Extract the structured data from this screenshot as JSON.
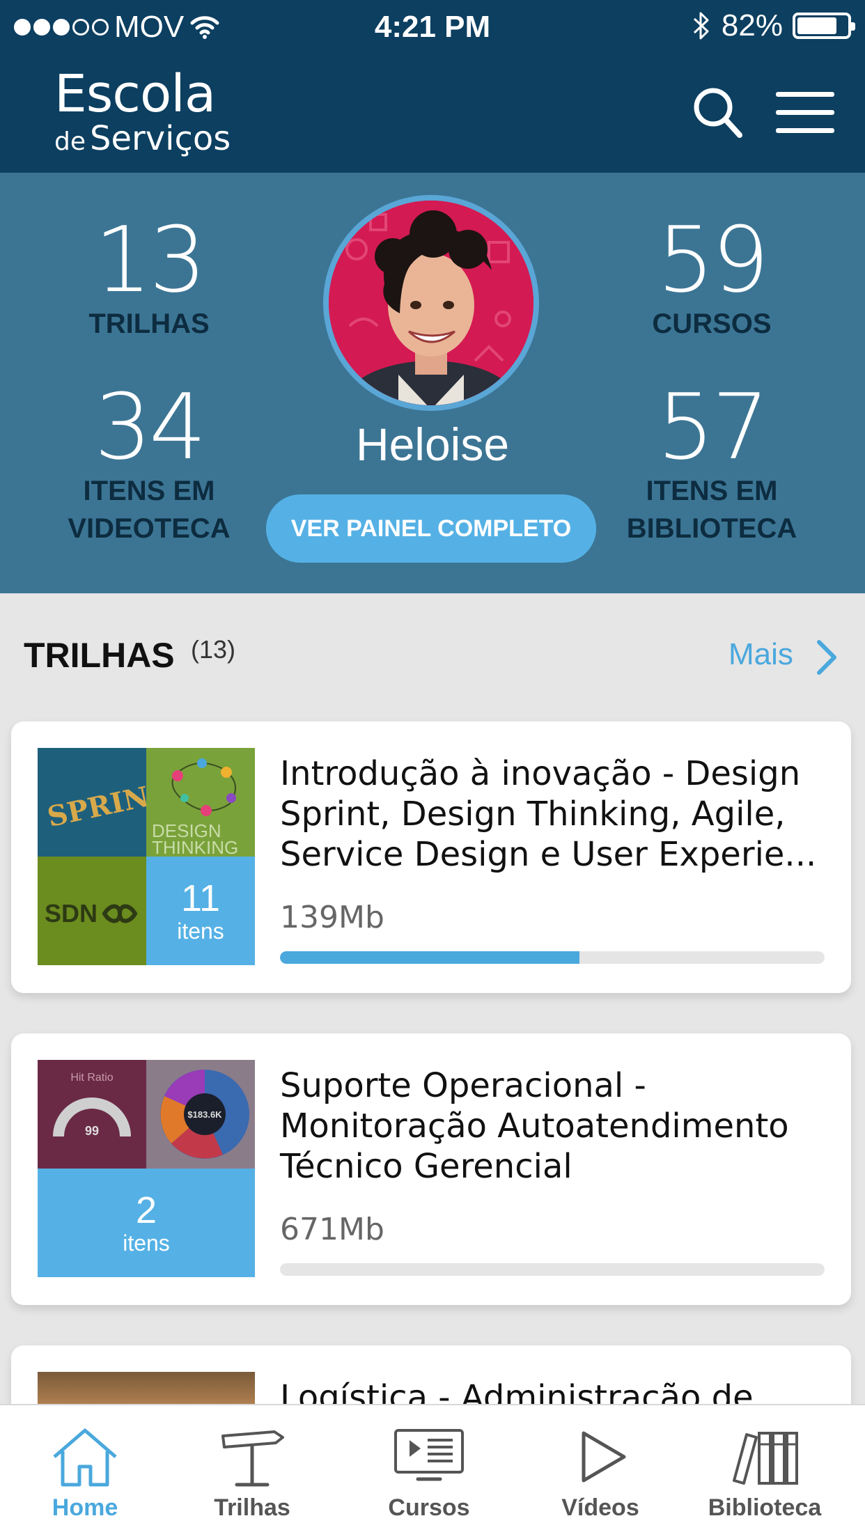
{
  "status_bar": {
    "carrier": "MOV",
    "time": "4:21 PM",
    "battery": "82%",
    "battery_level": 0.82,
    "signal_dots_filled": 3,
    "signal_dots_total": 5
  },
  "header": {
    "logo_line1": "Escola",
    "logo_line2_prefix": "de",
    "logo_line2": "Serviços"
  },
  "profile": {
    "name": "Heloise",
    "button": "VER PAINEL COMPLETO",
    "stats": [
      {
        "value": "13",
        "label": "TRILHAS"
      },
      {
        "value": "59",
        "label": "CURSOS"
      },
      {
        "value": "34",
        "label": "ITENS EM VIDEOTECA"
      },
      {
        "value": "57",
        "label": "ITENS EM BIBLIOTECA"
      }
    ]
  },
  "section": {
    "title": "TRILHAS",
    "count": "(13)",
    "more": "Mais"
  },
  "cards": [
    {
      "title": "Introdução à inovação - Design Sprint, Design Thinking, Agile, Service Design e User Experie...",
      "size": "139Mb",
      "items_count": "11",
      "items_word": "itens",
      "progress": 0.55,
      "tiles": {
        "sprint": "SPRINT",
        "design": "DESIGN",
        "thinking": "THINKING",
        "sdn": "SDN"
      }
    },
    {
      "title": "Suporte Operacional - Monitoração Autoatendimento Técnico Gerencial",
      "size": "671Mb",
      "items_count": "2",
      "items_word": "itens",
      "progress": 0,
      "tiles": {
        "gauge_title": "Hit Ratio",
        "gauge_value": "99",
        "donut_value": "$183.6K"
      }
    },
    {
      "title": "Logística - Administração de"
    }
  ],
  "tabbar": [
    {
      "label": "Home",
      "icon": "home-icon",
      "active": true
    },
    {
      "label": "Trilhas",
      "icon": "signpost-icon",
      "active": false
    },
    {
      "label": "Cursos",
      "icon": "course-screen-icon",
      "active": false
    },
    {
      "label": "Vídeos",
      "icon": "play-icon",
      "active": false
    },
    {
      "label": "Biblioteca",
      "icon": "books-icon",
      "active": false
    }
  ],
  "colors": {
    "header": "#0c3f60",
    "hero": "#3c7594",
    "accent": "#4aa8dd",
    "tile_blue": "#55b1e5"
  }
}
